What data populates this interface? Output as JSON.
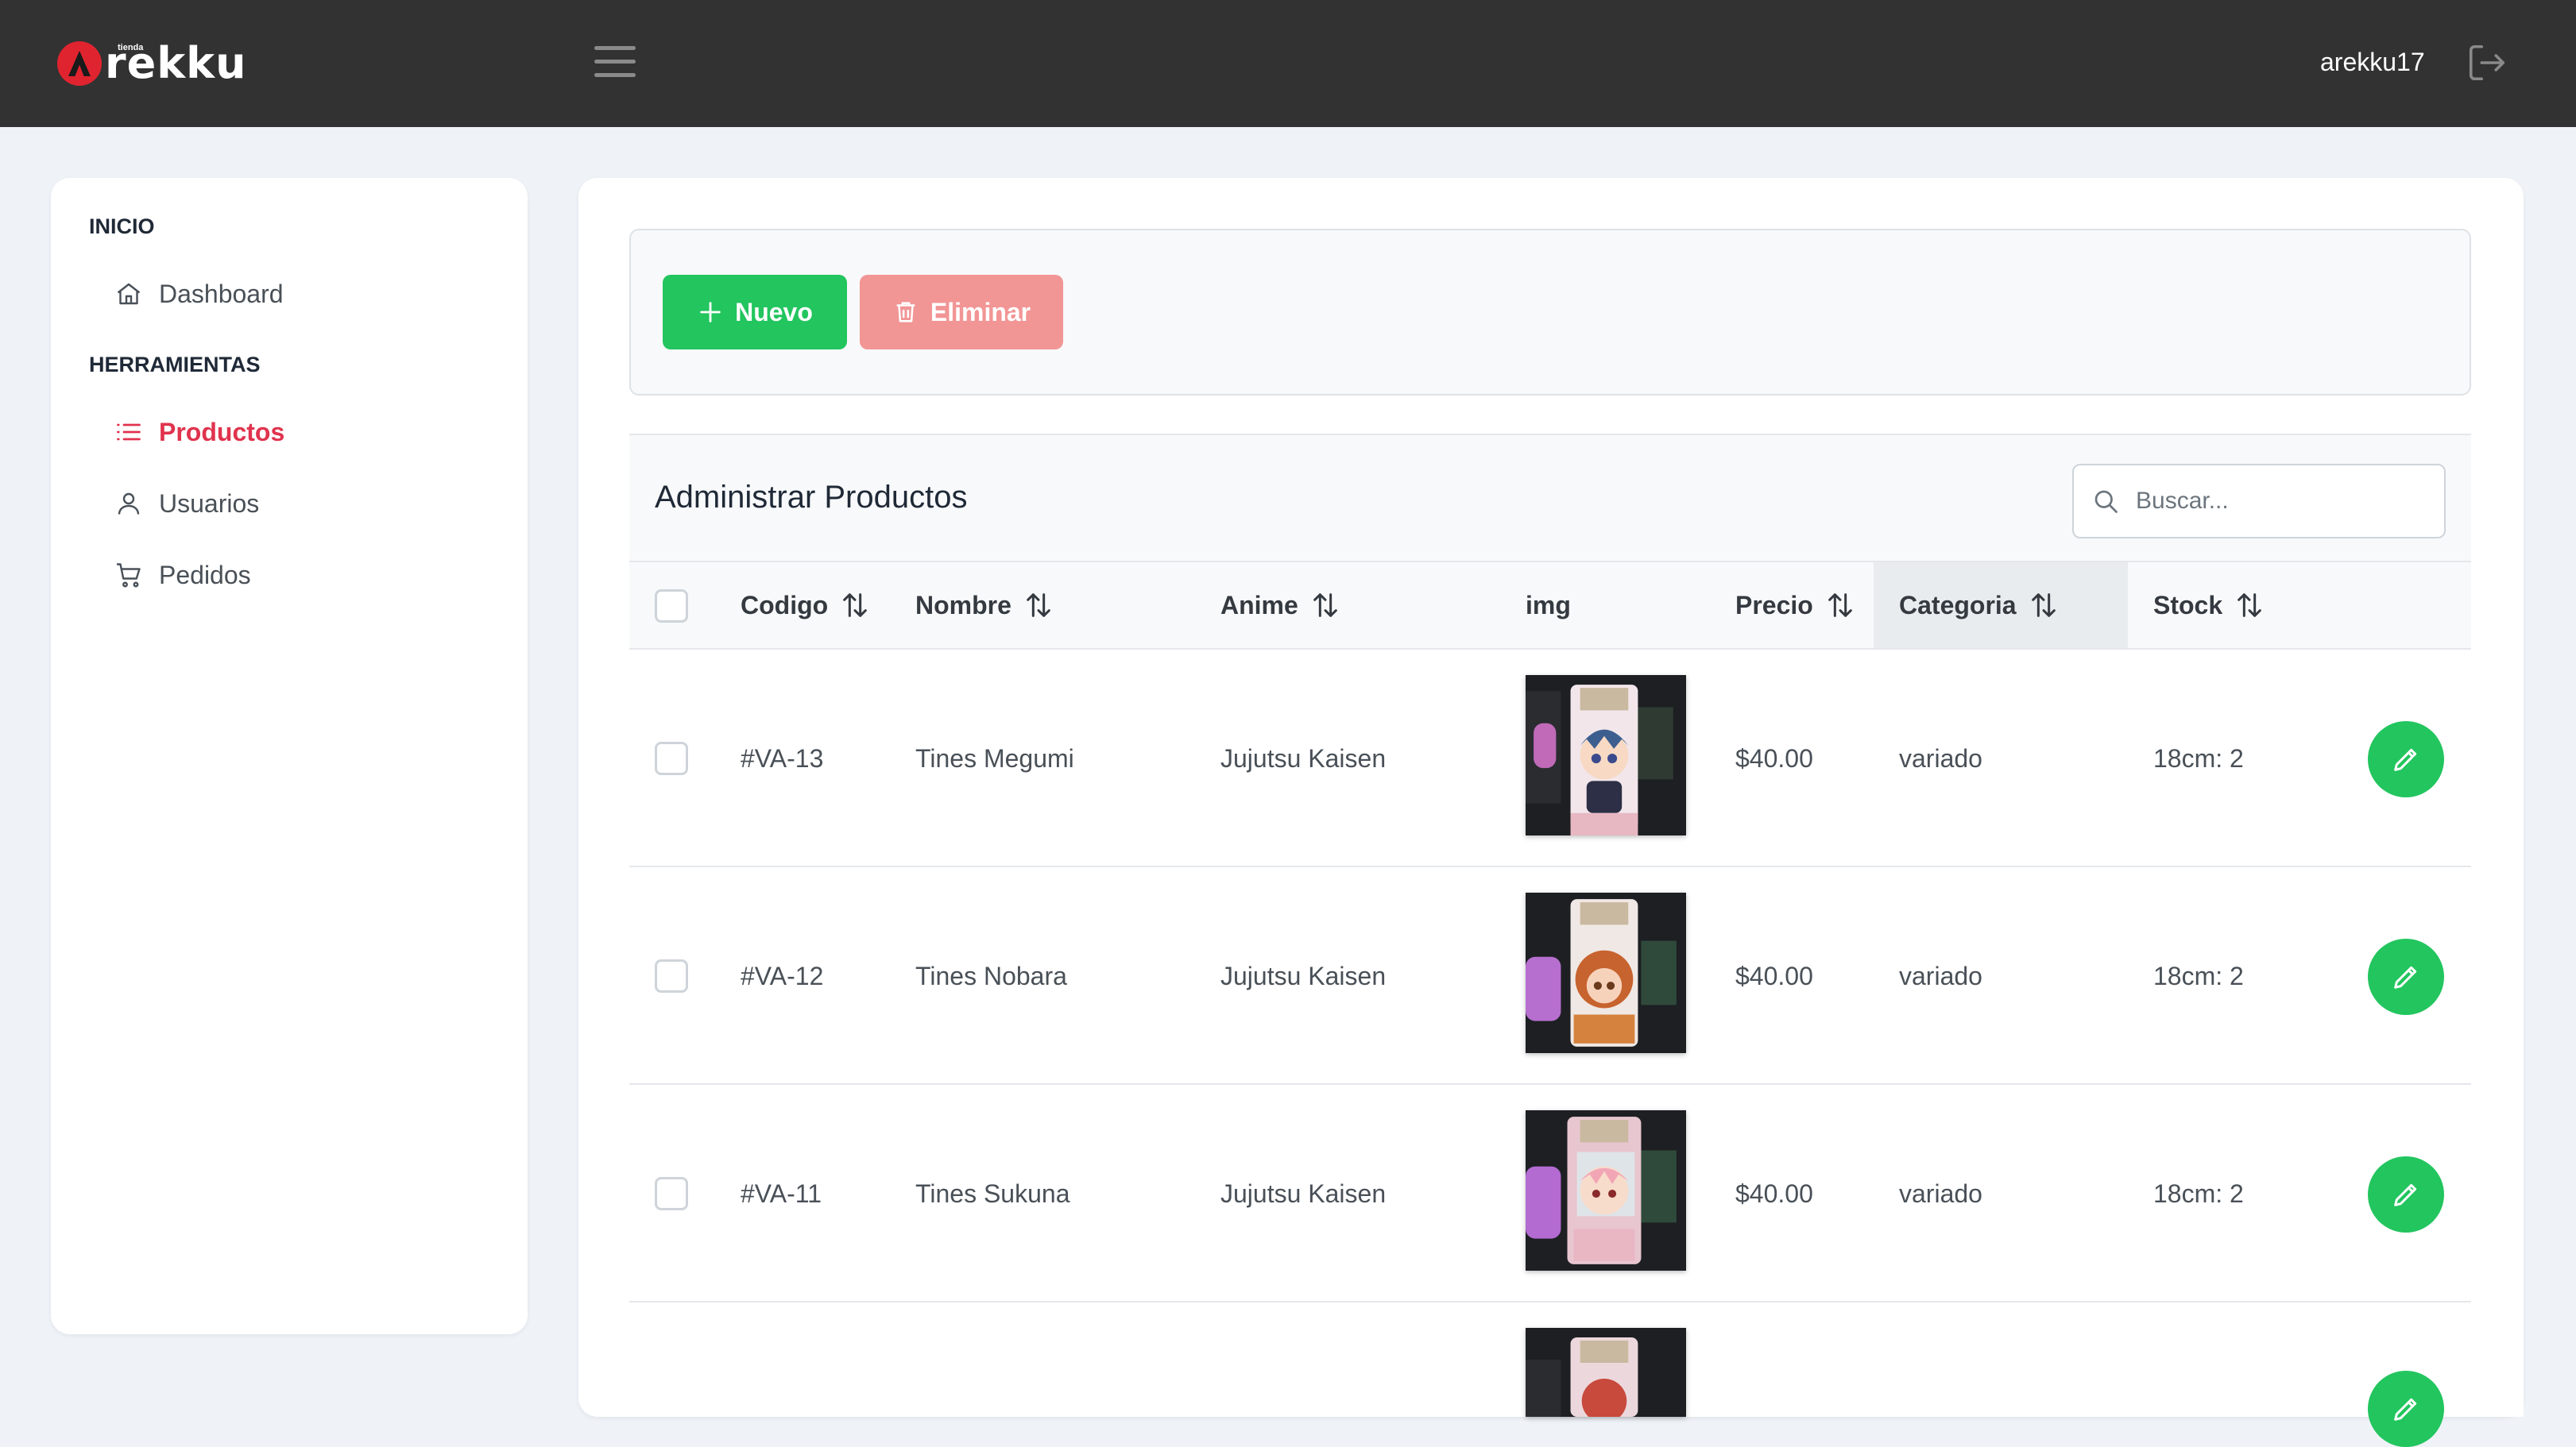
{
  "header": {
    "logo_text": "rekku",
    "logo_subtext": "tienda",
    "username": "arekku17"
  },
  "sidebar": {
    "sections": [
      {
        "title": "INICIO"
      },
      {
        "title": "HERRAMIENTAS"
      }
    ],
    "items": [
      {
        "label": "Dashboard",
        "icon": "home-icon"
      },
      {
        "label": "Productos",
        "icon": "list-icon",
        "active": true
      },
      {
        "label": "Usuarios",
        "icon": "user-icon"
      },
      {
        "label": "Pedidos",
        "icon": "cart-icon"
      }
    ]
  },
  "toolbar": {
    "new_label": "Nuevo",
    "delete_label": "Eliminar"
  },
  "table": {
    "title": "Administrar Productos",
    "search_placeholder": "Buscar...",
    "columns": [
      "Codigo",
      "Nombre",
      "Anime",
      "img",
      "Precio",
      "Categoria",
      "Stock"
    ],
    "rows": [
      {
        "codigo": "#VA-13",
        "nombre": "Tines Megumi",
        "anime": "Jujutsu Kaisen",
        "precio": "$40.00",
        "categoria": "variado",
        "stock": "18cm: 2"
      },
      {
        "codigo": "#VA-12",
        "nombre": "Tines Nobara",
        "anime": "Jujutsu Kaisen",
        "precio": "$40.00",
        "categoria": "variado",
        "stock": "18cm: 2"
      },
      {
        "codigo": "#VA-11",
        "nombre": "Tines Sukuna",
        "anime": "Jujutsu Kaisen",
        "precio": "$40.00",
        "categoria": "variado",
        "stock": "18cm: 2"
      }
    ]
  },
  "colors": {
    "accent_green": "#22c55e",
    "danger_light": "#f29595",
    "active_red": "#e0334d",
    "topbar": "#323232"
  }
}
